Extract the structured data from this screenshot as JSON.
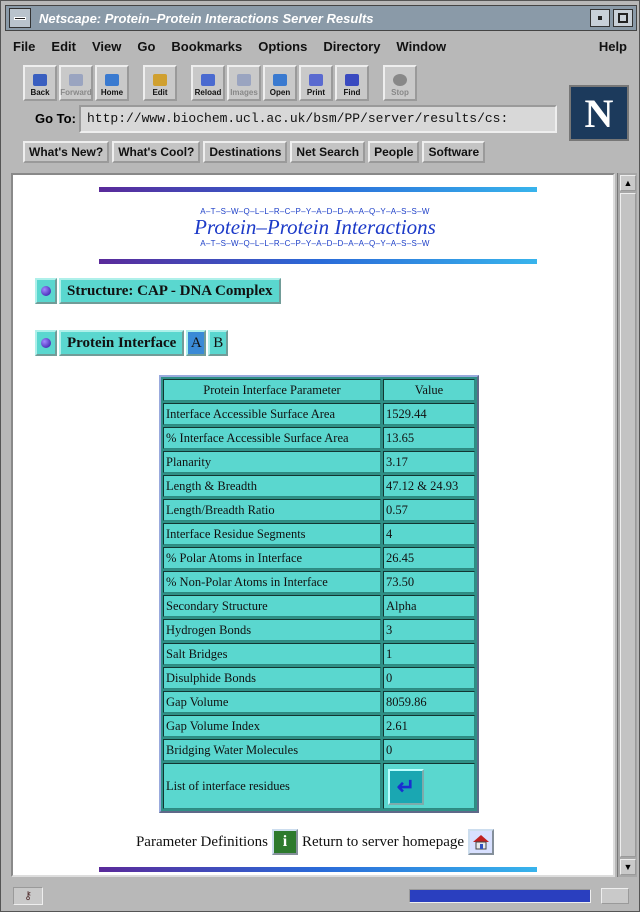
{
  "window": {
    "title": "Netscape: Protein–Protein Interactions Server Results"
  },
  "menu": {
    "items": [
      "File",
      "Edit",
      "View",
      "Go",
      "Bookmarks",
      "Options",
      "Directory",
      "Window"
    ],
    "help": "Help"
  },
  "toolbar": {
    "buttons": [
      {
        "label": "Back",
        "icon": "back-arrow-icon",
        "enabled": true
      },
      {
        "label": "Forward",
        "icon": "forward-arrow-icon",
        "enabled": false
      },
      {
        "label": "Home",
        "icon": "home-icon",
        "enabled": true
      },
      {
        "label": "Edit",
        "icon": "pencil-icon",
        "enabled": true
      },
      {
        "label": "Reload",
        "icon": "reload-icon",
        "enabled": true
      },
      {
        "label": "Images",
        "icon": "images-icon",
        "enabled": false
      },
      {
        "label": "Open",
        "icon": "open-icon",
        "enabled": true
      },
      {
        "label": "Print",
        "icon": "printer-icon",
        "enabled": true
      },
      {
        "label": "Find",
        "icon": "binoculars-icon",
        "enabled": true
      },
      {
        "label": "Stop",
        "icon": "stop-icon",
        "enabled": false
      }
    ]
  },
  "location": {
    "label": "Go To:",
    "url": "http://www.biochem.ucl.ac.uk/bsm/PP/server/results/cs:"
  },
  "directory_buttons": [
    "What's New?",
    "What's Cool?",
    "Destinations",
    "Net Search",
    "People",
    "Software"
  ],
  "page": {
    "sequence": "A–T–S–W–Q–L–L–R–C–P–Y–A–D–D–A–A–Q–Y–A–S–S–W",
    "banner": "Protein–Protein Interactions",
    "structure_label": "Structure: CAP - DNA Complex",
    "interface_label": "Protein Interface",
    "chain_a": "A",
    "chain_b": "B",
    "table": {
      "headers": [
        "Protein Interface Parameter",
        "Value"
      ],
      "rows": [
        [
          "Interface Accessible Surface Area",
          "1529.44"
        ],
        [
          "% Interface Accessible Surface Area",
          "13.65"
        ],
        [
          "Planarity",
          "3.17"
        ],
        [
          "Length & Breadth",
          "47.12 & 24.93"
        ],
        [
          "Length/Breadth Ratio",
          "0.57"
        ],
        [
          "Interface Residue Segments",
          "4"
        ],
        [
          "% Polar Atoms in Interface",
          "26.45"
        ],
        [
          "% Non-Polar Atoms in Interface",
          "73.50"
        ],
        [
          "Secondary Structure",
          "Alpha"
        ],
        [
          "Hydrogen Bonds",
          "3"
        ],
        [
          "Salt Bridges",
          "1"
        ],
        [
          "Disulphide Bonds",
          "0"
        ],
        [
          "Gap Volume",
          "8059.86"
        ],
        [
          "Gap Volume Index",
          "2.61"
        ],
        [
          "Bridging Water Molecules",
          "0"
        ],
        [
          "List of interface residues",
          ""
        ]
      ]
    },
    "footer": {
      "definitions": "Parameter Definitions",
      "return": "Return to server homepage"
    }
  },
  "status": {
    "progress": 1.0,
    "progress_color": "#2a3fbf"
  }
}
